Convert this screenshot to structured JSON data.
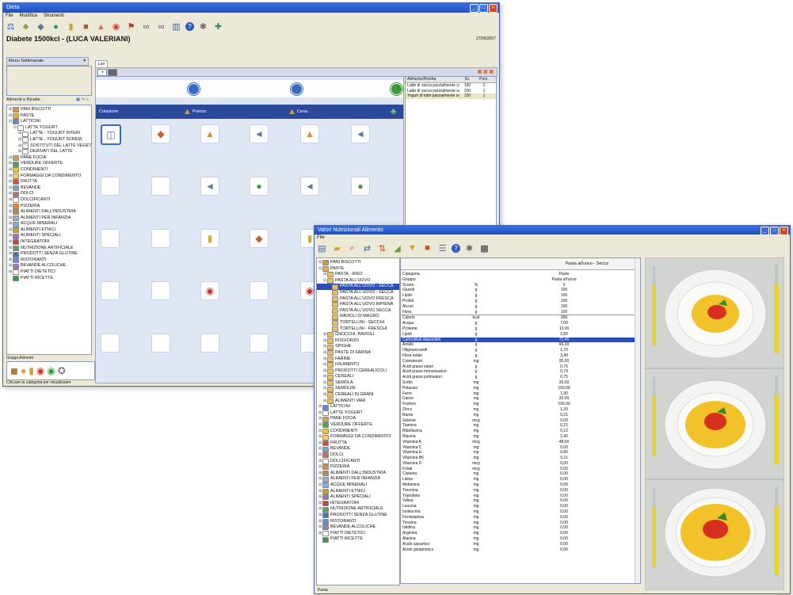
{
  "back_window": {
    "title": "Dieta",
    "menu": [
      "File",
      "Modifica",
      "Strumenti"
    ],
    "patient": "Diabete 1500kcl - (LUCA VALERIANI)",
    "date": "27/06/2007",
    "left_panel_title": "Menu Settimanale",
    "tree_header": "Alimenti e Ricette",
    "tree": [
      {
        "label": "PANI BISCOTTI",
        "level": 0,
        "exp": "+",
        "color": "#c89b4a"
      },
      {
        "label": "PASTE",
        "level": 0,
        "exp": "+",
        "color": "#e0b040"
      },
      {
        "label": "LATTICINI",
        "level": 0,
        "exp": "-",
        "color": "#6b86c8"
      },
      {
        "label": "LATTE YOGURT",
        "level": 1,
        "exp": "-",
        "color": "#ffffff"
      },
      {
        "label": "LATTE - YOGURT INTERI",
        "level": 2,
        "exp": "+",
        "color": "#ffffff"
      },
      {
        "label": "LATTE - YOGURT SCREM.",
        "level": 2,
        "exp": "+",
        "color": "#ffffff"
      },
      {
        "label": "SOSTITUTI DEL LATTE VEGETALI",
        "level": 2,
        "exp": "+",
        "color": "#ffffff"
      },
      {
        "label": "DERIVATI DEL LATTE",
        "level": 2,
        "exp": "+",
        "color": "#ffffff"
      },
      {
        "label": "PANE FOCIA",
        "level": 0,
        "exp": "+",
        "color": "#d4a15a"
      },
      {
        "label": "VERDURE OFFERTE",
        "level": 0,
        "exp": "+",
        "color": "#5aa04a"
      },
      {
        "label": "CONDIMENTI",
        "level": 0,
        "exp": "+",
        "color": "#e8c840"
      },
      {
        "label": "FORMAGGI DA CONDIMENTO",
        "level": 0,
        "exp": "+",
        "color": "#f0d070"
      },
      {
        "label": "FRUTTA",
        "level": 0,
        "exp": "+",
        "color": "#d84a3a"
      },
      {
        "label": "BEVANDE",
        "level": 0,
        "exp": "+",
        "color": "#7aa0d8"
      },
      {
        "label": "DOLCI",
        "level": 0,
        "exp": "+",
        "color": "#c0706a"
      },
      {
        "label": "DOLCIFICANTI",
        "level": 0,
        "exp": "+",
        "color": "#ffffff"
      },
      {
        "label": "PIZZERIA",
        "level": 0,
        "exp": "+",
        "color": "#e08a3a"
      },
      {
        "label": "ALIMENTI DALL'INDUSTRIA",
        "level": 0,
        "exp": "+",
        "color": "#b08a5a"
      },
      {
        "label": "ALIMENTI PER INFANZIA",
        "level": 0,
        "exp": "+",
        "color": "#9ab0d0"
      },
      {
        "label": "ACQUE MINERALI",
        "level": 0,
        "exp": "+",
        "color": "#7ab0e0"
      },
      {
        "label": "ALIMENTI ETNICI",
        "level": 0,
        "exp": "+",
        "color": "#c0a040"
      },
      {
        "label": "ALIMENTI SPECIALI",
        "level": 0,
        "exp": "+",
        "color": "#a070b0"
      },
      {
        "label": "INTEGRATORI",
        "level": 0,
        "exp": "+",
        "color": "#d04040"
      },
      {
        "label": "NUTRIZIONE ARTIFICIALE",
        "level": 0,
        "exp": "+",
        "color": "#60a060"
      },
      {
        "label": "PRODOTTI SENZA GLUTINE",
        "level": 0,
        "exp": "+",
        "color": "#4a70c0"
      },
      {
        "label": "RISTORANTI",
        "level": 0,
        "exp": "+",
        "color": "#6a8ac8"
      },
      {
        "label": "BEVANDE ALCOLICHE",
        "level": 0,
        "exp": "+",
        "color": "#9a7ac0"
      },
      {
        "label": "PIATTI DIETETICI",
        "level": 0,
        "exp": "+",
        "color": "#ffffff"
      },
      {
        "label": "PIATTI RICETTE",
        "level": 0,
        "exp": "",
        "color": "#3a9a3a"
      }
    ],
    "bottom_panel_title": "Gruppi Alimenti",
    "status": "Cliccare la categoria per visualizzare",
    "tab_label": "Lun",
    "meal_headers": [
      "Colazione",
      "Pranzo",
      "Cena"
    ],
    "meal_grid": [
      [
        "milk",
        "bread",
        "cake",
        "fish",
        "cake",
        "fish"
      ],
      [
        "",
        "",
        "fish",
        "veg",
        "fish",
        "veg"
      ],
      [
        "",
        "",
        "bottle",
        "bread",
        "bottle",
        ""
      ],
      [
        "",
        "",
        "fruit",
        "",
        "fruit",
        ""
      ],
      [
        "",
        "",
        "",
        "",
        "",
        ""
      ]
    ],
    "right_list_headers": [
      "Alimento/Ricetta",
      "Gr.",
      "Porz."
    ],
    "right_list": [
      {
        "name": "Latte di vacca parzialmente scremato",
        "g": "150",
        "p": "1"
      },
      {
        "name": "Latte di vacca parzialmente scremato",
        "g": "200",
        "p": "1"
      },
      {
        "name": "Yogurt di latte parzialmente scremato",
        "g": "150",
        "p": "1"
      }
    ]
  },
  "front_window": {
    "title": "Valori Nutrizionali Alimento",
    "menu": [
      "File"
    ],
    "tree": [
      {
        "label": "PANI BISCOTTI",
        "level": 0,
        "exp": "+",
        "color": "#c89b4a"
      },
      {
        "label": "PASTE",
        "level": 0,
        "exp": "-",
        "color": "#e0b040"
      },
      {
        "label": "PASTA - RISO",
        "level": 1,
        "exp": "+",
        "color": "#e8c060"
      },
      {
        "label": "PASTA ALL'UOVO",
        "level": 1,
        "exp": "-",
        "color": "#e8c060"
      },
      {
        "label": "PASTA ALL'UOVO - SECCA",
        "level": 2,
        "exp": "",
        "color": "#e8c060",
        "selected": true
      },
      {
        "label": "PASTA ALL'UOVO - SECCA",
        "level": 2,
        "exp": "",
        "color": "#e8c060"
      },
      {
        "label": "PASTA ALL'UOVO FRESCA",
        "level": 2,
        "exp": "",
        "color": "#e8c060"
      },
      {
        "label": "PASTA ALL'UOVO RIPIENA",
        "level": 2,
        "exp": "",
        "color": "#e8c060"
      },
      {
        "label": "PASTA ALL'UOVO SECCA",
        "level": 2,
        "exp": "",
        "color": "#e8c060"
      },
      {
        "label": "RAVIOLI DI MAGRO",
        "level": 2,
        "exp": "",
        "color": "#e8c060"
      },
      {
        "label": "TORTELLINI - SECCHI",
        "level": 2,
        "exp": "",
        "color": "#e8c060"
      },
      {
        "label": "TORTELLINI - FRESCHI",
        "level": 2,
        "exp": "",
        "color": "#e8c060"
      },
      {
        "label": "GNOCCHI, RAVIOLI",
        "level": 1,
        "exp": "+",
        "color": "#e8c060"
      },
      {
        "label": "RISO/ORZO",
        "level": 1,
        "exp": "+",
        "color": "#e8c060"
      },
      {
        "label": "SPIGHE",
        "level": 1,
        "exp": "+",
        "color": "#e8c060"
      },
      {
        "label": "PASTE DI FARINA",
        "level": 1,
        "exp": "+",
        "color": "#e8c060"
      },
      {
        "label": "FARINE",
        "level": 1,
        "exp": "+",
        "color": "#e8c060"
      },
      {
        "label": "FRUMENTO",
        "level": 1,
        "exp": "+",
        "color": "#e8c060"
      },
      {
        "label": "PRODOTTI CEREALICOLI",
        "level": 1,
        "exp": "+",
        "color": "#e8c060"
      },
      {
        "label": "CEREALI",
        "level": 1,
        "exp": "+",
        "color": "#e8c060"
      },
      {
        "label": "SEMOLA",
        "level": 1,
        "exp": "+",
        "color": "#e8c060"
      },
      {
        "label": "SEMOLINI",
        "level": 1,
        "exp": "+",
        "color": "#e8c060"
      },
      {
        "label": "CEREALI IN GRANI",
        "level": 1,
        "exp": "+",
        "color": "#e8c060"
      },
      {
        "label": "ALIMENTI VARI",
        "level": 1,
        "exp": "+",
        "color": "#e8c060"
      },
      {
        "label": "LATTICINI",
        "level": 0,
        "exp": "+",
        "color": "#6b86c8"
      },
      {
        "label": "LATTE YOGURT",
        "level": 0,
        "exp": "+",
        "color": "#ffffff"
      },
      {
        "label": "PANE FOCIA",
        "level": 0,
        "exp": "+",
        "color": "#d4a15a"
      },
      {
        "label": "VERDURE OFFERTE",
        "level": 0,
        "exp": "+",
        "color": "#5aa04a"
      },
      {
        "label": "CONDIMENTI",
        "level": 0,
        "exp": "+",
        "color": "#e8c840"
      },
      {
        "label": "FORMAGGI DA CONDIMENTO",
        "level": 0,
        "exp": "+",
        "color": "#f0d070"
      },
      {
        "label": "FRUTTA",
        "level": 0,
        "exp": "+",
        "color": "#d84a3a"
      },
      {
        "label": "BEVANDE",
        "level": 0,
        "exp": "+",
        "color": "#7aa0d8"
      },
      {
        "label": "DOLCI",
        "level": 0,
        "exp": "+",
        "color": "#c0706a"
      },
      {
        "label": "DOLCIFICANTI",
        "level": 0,
        "exp": "+",
        "color": "#ffffff"
      },
      {
        "label": "PIZZERIA",
        "level": 0,
        "exp": "+",
        "color": "#e08a3a"
      },
      {
        "label": "ALIMENTI DALL'INDUSTRIA",
        "level": 0,
        "exp": "+",
        "color": "#b08a5a"
      },
      {
        "label": "ALIMENTI PER INFANZIA",
        "level": 0,
        "exp": "+",
        "color": "#9ab0d0"
      },
      {
        "label": "ACQUE MINERALI",
        "level": 0,
        "exp": "+",
        "color": "#7ab0e0"
      },
      {
        "label": "ALIMENTI ETNICI",
        "level": 0,
        "exp": "+",
        "color": "#c0a040"
      },
      {
        "label": "ALIMENTI SPECIALI",
        "level": 0,
        "exp": "+",
        "color": "#a070b0"
      },
      {
        "label": "INTEGRATORI",
        "level": 0,
        "exp": "+",
        "color": "#d04040"
      },
      {
        "label": "NUTRIZIONE ARTIFICIALE",
        "level": 0,
        "exp": "+",
        "color": "#60a060"
      },
      {
        "label": "PRODOTTI SENZA GLUTINE",
        "level": 0,
        "exp": "+",
        "color": "#4a70c0"
      },
      {
        "label": "RISTORANTI",
        "level": 0,
        "exp": "+",
        "color": "#6a8ac8"
      },
      {
        "label": "BEVANDE ALCOLICHE",
        "level": 0,
        "exp": "+",
        "color": "#9a7ac0"
      },
      {
        "label": "PIATTI DIETETICI",
        "level": 0,
        "exp": "+",
        "color": "#ffffff"
      },
      {
        "label": "PIATTI RICETTE",
        "level": 0,
        "exp": "",
        "color": "#3a9a3a"
      }
    ],
    "table_header": "Pasta all'uovo - Secca",
    "nutrients": [
      {
        "name": "Categoria",
        "unit": "",
        "value": "Paste"
      },
      {
        "name": "Gruppo",
        "unit": "",
        "value": "Pasta all'uovo"
      },
      {
        "name": "Scarto",
        "unit": "%",
        "value": "0"
      },
      {
        "name": "Glucidi",
        "unit": "g",
        "value": "100"
      },
      {
        "name": "Lipidi",
        "unit": "g",
        "value": "100"
      },
      {
        "name": "Protidi",
        "unit": "g",
        "value": "100"
      },
      {
        "name": "Alcool",
        "unit": "g",
        "value": "100"
      },
      {
        "name": "Fibra",
        "unit": "g",
        "value": "100"
      },
      {
        "name": "Calorie",
        "unit": "kcal",
        "value": "366"
      },
      {
        "name": "Acqua",
        "unit": "g",
        "value": "7,00"
      },
      {
        "name": "Proteine",
        "unit": "g",
        "value": "13,00"
      },
      {
        "name": "Lipidi",
        "unit": "g",
        "value": "2,80"
      },
      {
        "name": "Carboidrati disponibili",
        "unit": "g",
        "value": "72,40",
        "highlight": true
      },
      {
        "name": "Amido",
        "unit": "g",
        "value": "66,00"
      },
      {
        "name": "Oligosaccaridi",
        "unit": "g",
        "value": "1,70"
      },
      {
        "name": "Fibra totale",
        "unit": "g",
        "value": "3,40"
      },
      {
        "name": "Colesterolo",
        "unit": "mg",
        "value": "95,00"
      },
      {
        "name": "Acidi grassi saturi",
        "unit": "g",
        "value": "0,76"
      },
      {
        "name": "Acidi grassi monoinsaturi",
        "unit": "g",
        "value": "0,79"
      },
      {
        "name": "Acidi grassi polinsaturi",
        "unit": "g",
        "value": "0,75"
      },
      {
        "name": "Sodio",
        "unit": "mg",
        "value": "25,00"
      },
      {
        "name": "Potassio",
        "unit": "mg",
        "value": "150,00"
      },
      {
        "name": "Ferro",
        "unit": "mg",
        "value": "1,90"
      },
      {
        "name": "Calcio",
        "unit": "mg",
        "value": "20,00"
      },
      {
        "name": "Fosforo",
        "unit": "mg",
        "value": "190,00"
      },
      {
        "name": "Zinco",
        "unit": "mg",
        "value": "1,20"
      },
      {
        "name": "Rame",
        "unit": "mg",
        "value": "0,21"
      },
      {
        "name": "Selenio",
        "unit": "mcg",
        "value": "0,00"
      },
      {
        "name": "Tiamina",
        "unit": "mg",
        "value": "0,21"
      },
      {
        "name": "Riboflavina",
        "unit": "mg",
        "value": "0,12"
      },
      {
        "name": "Niacina",
        "unit": "mg",
        "value": "2,40"
      },
      {
        "name": "Vitamina A",
        "unit": "mcg",
        "value": "48,00"
      },
      {
        "name": "Vitamina C",
        "unit": "mg",
        "value": "0,00"
      },
      {
        "name": "Vitamina E",
        "unit": "mg",
        "value": "0,80"
      },
      {
        "name": "Vitamina B6",
        "unit": "mg",
        "value": "0,11"
      },
      {
        "name": "Vitamina D",
        "unit": "mcg",
        "value": "0,00"
      },
      {
        "name": "Folati",
        "unit": "mcg",
        "value": "0,00"
      },
      {
        "name": "Cisteina",
        "unit": "mg",
        "value": "0,00"
      },
      {
        "name": "Lisina",
        "unit": "mg",
        "value": "0,00"
      },
      {
        "name": "Metionina",
        "unit": "mg",
        "value": "0,00"
      },
      {
        "name": "Treonina",
        "unit": "mg",
        "value": "0,00"
      },
      {
        "name": "Triptofano",
        "unit": "mg",
        "value": "0,00"
      },
      {
        "name": "Valina",
        "unit": "mg",
        "value": "0,00"
      },
      {
        "name": "Leucina",
        "unit": "mg",
        "value": "0,00"
      },
      {
        "name": "Isoleucina",
        "unit": "mg",
        "value": "0,00"
      },
      {
        "name": "Fenilalanina",
        "unit": "mg",
        "value": "0,00"
      },
      {
        "name": "Tirosina",
        "unit": "mg",
        "value": "0,00"
      },
      {
        "name": "Istidina",
        "unit": "mg",
        "value": "0,00"
      },
      {
        "name": "Arginina",
        "unit": "mg",
        "value": "0,00"
      },
      {
        "name": "Alanina",
        "unit": "mg",
        "value": "0,00"
      },
      {
        "name": "Acido aspartico",
        "unit": "mg",
        "value": "0,00"
      },
      {
        "name": "Acido glutammico",
        "unit": "mg",
        "value": "0,00"
      }
    ],
    "status": "Pasta"
  },
  "colors": {
    "titlebar": "#1e4fc2",
    "grid_bg": "#dfe7f5",
    "meal_header": "#2c4a9a",
    "selection": "#2b4fb8",
    "window_bg": "#ece9d8"
  }
}
